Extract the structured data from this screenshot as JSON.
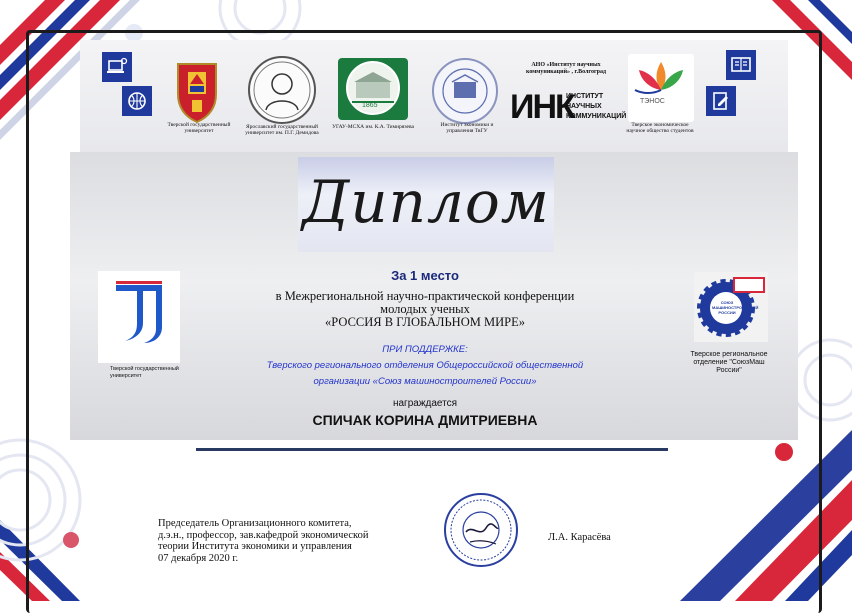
{
  "header": {
    "logos": [
      {
        "name": "tver-state-university-crest",
        "caption": "Тверской государственный университет"
      },
      {
        "name": "yaroslavl-university-portrait",
        "caption": "Ярославский государственный университет им. П.Г. Демидова"
      },
      {
        "name": "ugau-mcxa-logo",
        "caption": "УГАУ-МСХА им. К.А. Тимирязева",
        "year": "1865"
      },
      {
        "name": "institute-economics-logo",
        "caption": "Институт экономики и управления ТвГУ"
      },
      {
        "name": "ink-logo",
        "title": "АНО «Институт научных коммуникаций» , г.Волгоград",
        "mark": "ИНК",
        "text": "ИНСТИТУТ НАУЧНЫХ КОММУНИКАЦИЙ"
      },
      {
        "name": "teonos-logo",
        "mark": "ТЭНОС",
        "caption": "Тверское экономическое научное общество студентов"
      }
    ]
  },
  "diploma": {
    "title": "Диплом"
  },
  "award": {
    "place": "За 1 место",
    "conference_line1": "в Межрегиональной научно-практической конференции",
    "conference_line2": "молодых ученых",
    "conference_title": "«РОССИЯ В ГЛОБАЛЬНОМ МИРЕ»",
    "support_label": "ПРИ ПОДДЕРЖКЕ:",
    "support_line1": "Тверского регионального отделения Общероссийской общественной",
    "support_line2": "организации «Союз машиностроителей России»",
    "awarded": "награждается",
    "recipient": "СПИЧАК КОРИНА ДМИТРИЕВНА"
  },
  "left_logo": {
    "caption": "Тверской государственный университет"
  },
  "right_logo": {
    "mark": "СОЮЗ МАШИНОСТРОИТЕЛЕЙ РОССИИ",
    "caption": "Тверское региональное отделение \"СоюзМаш России\""
  },
  "signature": {
    "line1": "Председатель Организационного комитета,",
    "line2": "д.э.н., профессор, зав.кафедрой экономической",
    "line3": "теории Института экономики и управления",
    "date": "07 декабря 2020 г.",
    "signer": "Л.А. Карасёва"
  },
  "colors": {
    "accent_red": "#d8263a",
    "accent_blue": "#1f3a9c",
    "navy_rule": "#283a62"
  }
}
